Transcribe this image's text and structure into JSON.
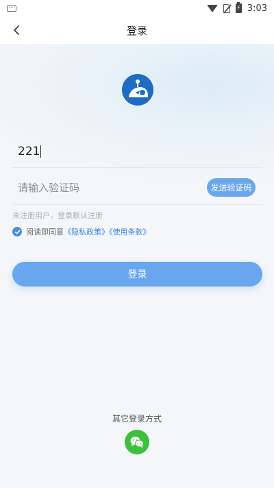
{
  "status_bar": {
    "time": "3:03"
  },
  "nav": {
    "title": "登录"
  },
  "form": {
    "phone_value": "221",
    "code_placeholder": "请输入验证码",
    "send_code_label": "发送验证码",
    "hint": "未注册用户，登录默认注册",
    "agree_prefix": "阅读即同意",
    "privacy_link": "《隐私政策》",
    "terms_link": "《使用条款》",
    "agreed": true,
    "login_label": "登录"
  },
  "other_login": {
    "title": "其它登录方式",
    "options": [
      "wechat"
    ]
  },
  "colors": {
    "accent": "#6aa6ee",
    "link": "#3f86dc",
    "logo": "#1e6cc4",
    "wechat": "#3ec03c"
  }
}
